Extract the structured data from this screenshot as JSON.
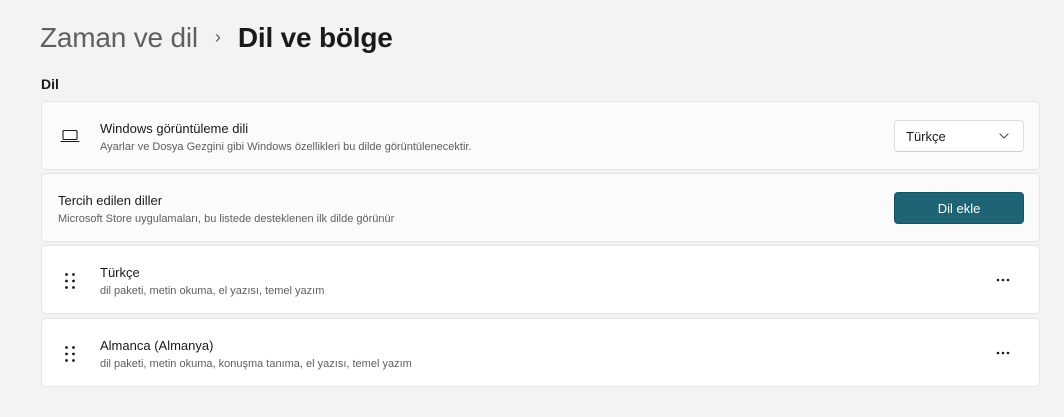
{
  "breadcrumb": {
    "parent": "Zaman ve dil",
    "separator": "›",
    "current": "Dil ve bölge"
  },
  "section": {
    "title": "Dil"
  },
  "display_language": {
    "icon": "laptop-icon",
    "title": "Windows görüntüleme dili",
    "description": "Ayarlar ve Dosya Gezgini gibi Windows özellikleri bu dilde görüntülenecektir.",
    "selected_value": "Türkçe"
  },
  "preferred_languages": {
    "title": "Tercih edilen diller",
    "description": "Microsoft Store uygulamaları, bu listede desteklenen ilk dilde görünür",
    "add_button_label": "Dil ekle"
  },
  "languages": [
    {
      "name": "Türkçe",
      "features": "dil paketi, metin okuma, el yazısı, temel yazım"
    },
    {
      "name": "Almanca (Almanya)",
      "features": "dil paketi, metin okuma, konuşma tanıma, el yazısı, temel yazım"
    }
  ],
  "colors": {
    "background": "#f3f3f3",
    "card": "#fbfbfb",
    "accent_button": "#1e6474"
  }
}
